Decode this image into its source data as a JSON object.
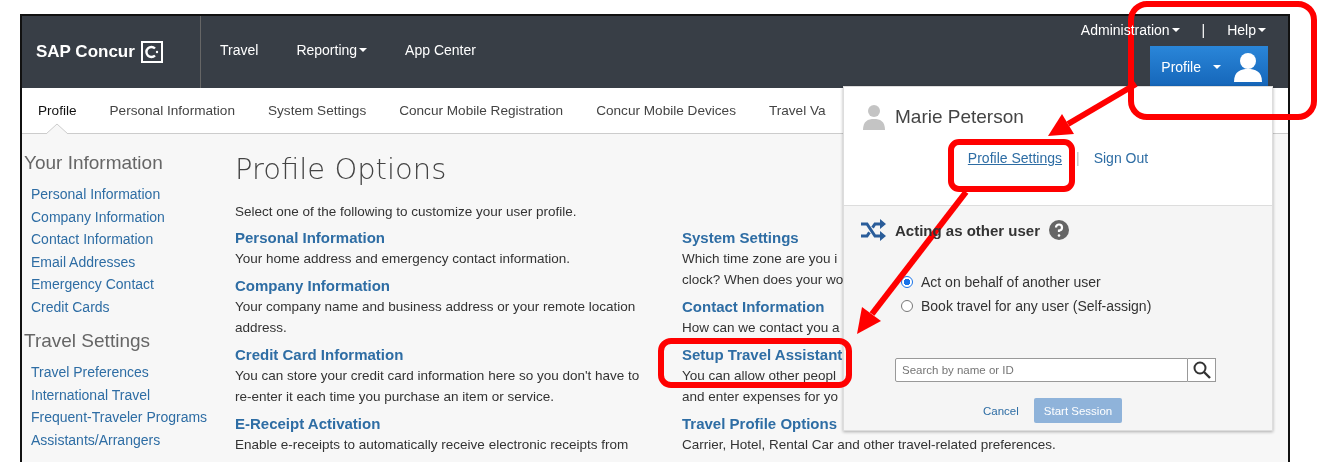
{
  "header": {
    "logo": "SAP Concur",
    "nav": [
      {
        "label": "Travel",
        "dropdown": false
      },
      {
        "label": "Reporting",
        "dropdown": true
      },
      {
        "label": "App Center",
        "dropdown": false
      }
    ],
    "utility": [
      {
        "label": "Administration",
        "dropdown": true
      },
      {
        "label": "Help",
        "dropdown": true
      }
    ],
    "utility_separator": "|",
    "profile_button": "Profile"
  },
  "tabs": [
    {
      "label": "Profile",
      "selected": true
    },
    {
      "label": "Personal Information",
      "selected": false
    },
    {
      "label": "System Settings",
      "selected": false
    },
    {
      "label": "Concur Mobile Registration",
      "selected": false
    },
    {
      "label": "Concur Mobile Devices",
      "selected": false
    },
    {
      "label": "Travel Va",
      "selected": false
    }
  ],
  "sidebar": [
    {
      "title": "Your Information",
      "items": [
        "Personal Information",
        "Company Information",
        "Contact Information",
        "Email Addresses",
        "Emergency Contact",
        "Credit Cards"
      ]
    },
    {
      "title": "Travel Settings",
      "items": [
        "Travel Preferences",
        "International Travel",
        "Frequent-Traveler Programs",
        "Assistants/Arrangers"
      ]
    }
  ],
  "main": {
    "title": "Profile Options",
    "intro": "Select one of the following to customize your user profile.",
    "options": [
      {
        "title": "Personal Information",
        "description": "Your home address and emergency contact information."
      },
      {
        "title": "Company Information",
        "description": "Your company name and business address or your remote location address."
      },
      {
        "title": "Credit Card Information",
        "description": "You can store your credit card information here so you don't have to re-enter it each time you purchase an item or service."
      },
      {
        "title": "E-Receipt Activation",
        "description": "Enable e-receipts to automatically receive electronic receipts from"
      }
    ]
  },
  "right_column": [
    {
      "title": "System Settings",
      "lines": [
        "Which time zone are you i",
        "clock? When does your wo"
      ]
    },
    {
      "title": "Contact Information",
      "lines": [
        "How can we contact you a"
      ]
    },
    {
      "title": "Setup Travel Assistant",
      "lines": [
        "You can allow other peopl",
        "and enter expenses for yo"
      ]
    },
    {
      "title": "Travel Profile Options",
      "lines": [
        "Carrier, Hotel, Rental Car and other travel-related preferences."
      ]
    }
  ],
  "profile_menu": {
    "user_name": "Marie Peterson",
    "links": [
      {
        "label": "Profile Settings",
        "underlined": true
      },
      {
        "label": "Sign Out",
        "underlined": false
      }
    ],
    "link_separator": "|",
    "acting_title": "Acting as other user",
    "options": [
      {
        "label": "Act on behalf of another user",
        "selected": true
      },
      {
        "label": "Book travel for any user (Self-assign)",
        "selected": false
      }
    ],
    "search": {
      "placeholder": "Search by name or ID"
    },
    "cancel": "Cancel",
    "start_session": {
      "label": "Start Session",
      "disabled": true
    }
  }
}
